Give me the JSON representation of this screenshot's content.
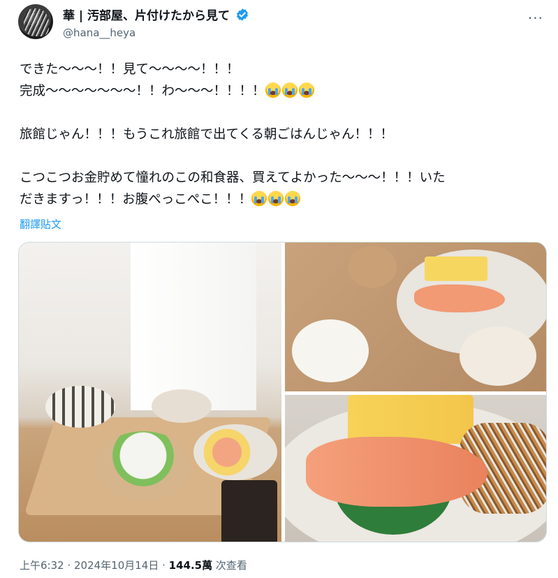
{
  "author": {
    "display_name": "華 | 汚部屋、片付けたから見て",
    "handle": "@hana__heya",
    "verified": true
  },
  "icons": [
    "avatar",
    "verified-badge-icon",
    "more-icon",
    "crying-face-emoji"
  ],
  "colors": {
    "accent": "#1d9bf0",
    "secondary_text": "#536471",
    "text": "#0f1419"
  },
  "tweet": {
    "line1": "できた～～～！！見て～～～～！！！",
    "line2": "完成～～～～～～～！！わ～～～！！！！",
    "line3": "旅館じゃん！！！もうこれ旅館で出てくる朝ごはんじゃん！！！",
    "line4": "こつこつお金貯めて憧れのこの和食器、買えてよかった～～～！！！いた",
    "line5": "だきますっ！！！お腹ぺっこぺこ！！！"
  },
  "translate_label": "翻譯貼文",
  "meta": {
    "time": "上午6:32",
    "sep1": " · ",
    "date": "2024年10月14日",
    "sep2": " · ",
    "views": "144.5萬",
    "views_label": " 次查看"
  }
}
